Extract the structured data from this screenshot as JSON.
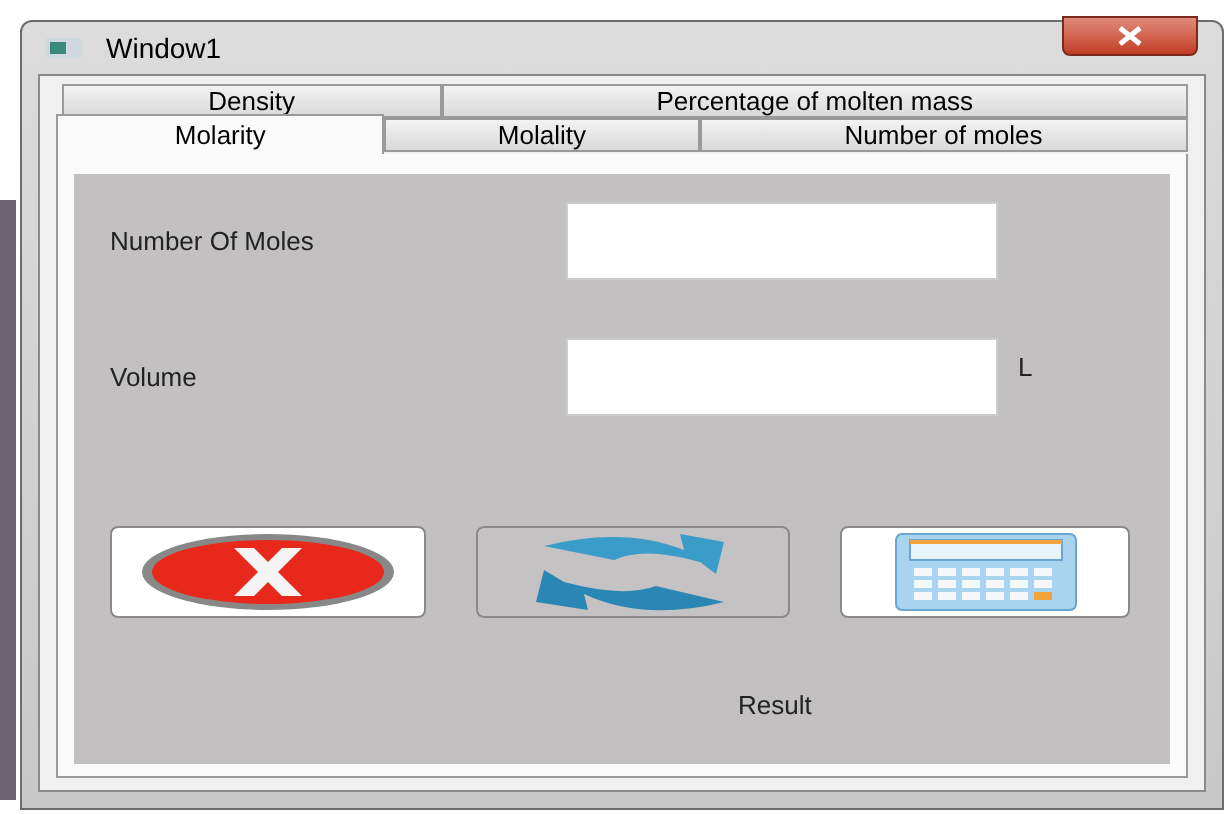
{
  "window": {
    "title": "Window1"
  },
  "tab_rows": [
    [
      {
        "label": "Density",
        "selected": false
      },
      {
        "label": "Percentage of molten mass",
        "selected": false
      }
    ],
    [
      {
        "label": "Molarity",
        "selected": true
      },
      {
        "label": "Molality",
        "selected": false
      },
      {
        "label": "Number of moles",
        "selected": false
      }
    ]
  ],
  "fields": [
    {
      "label": "Number Of Moles"
    },
    {
      "label": "Volume",
      "unit": "L"
    }
  ],
  "buttons": [
    {
      "kind": "cancel"
    },
    {
      "kind": "swap"
    },
    {
      "kind": "calculate"
    }
  ],
  "result": "Result"
}
